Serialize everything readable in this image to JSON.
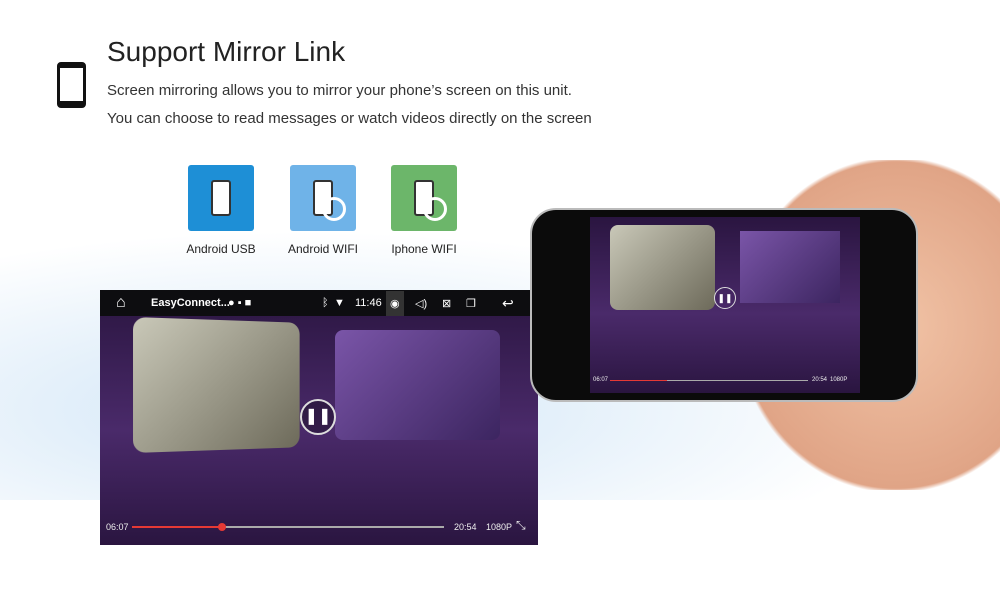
{
  "header": {
    "title": "Support Mirror Link",
    "line1": "Screen mirroring allows you to mirror your phone’s screen on this unit.",
    "line2": "You can choose to read messages or watch videos directly on the screen"
  },
  "modes": [
    {
      "label": "Android USB",
      "color": "#1e8fd6"
    },
    {
      "label": "Android WIFI",
      "color": "#6fb3e8"
    },
    {
      "label": "Iphone WIFI",
      "color": "#6cb66a"
    }
  ],
  "car": {
    "app_name": "EasyConnect...",
    "time": "11:46",
    "icons": [
      "home-icon",
      "bluetooth-icon",
      "wifi-icon",
      "camera-icon",
      "volume-icon",
      "close-icon",
      "recents-icon",
      "back-icon"
    ]
  },
  "player": {
    "elapsed": "06:07",
    "duration": "20:54",
    "quality": "1080P",
    "progress": 0.29
  }
}
